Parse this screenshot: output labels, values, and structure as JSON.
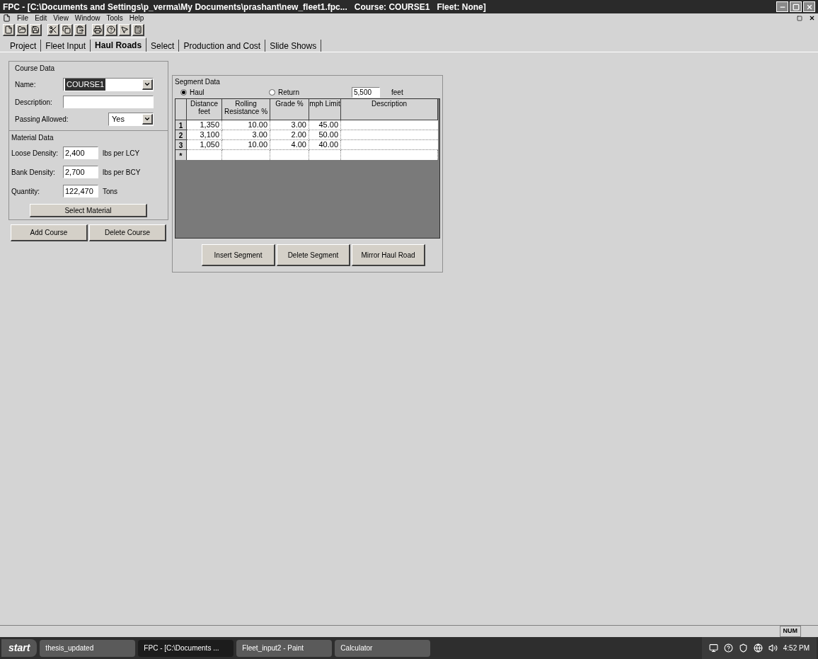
{
  "window": {
    "title": "FPC - [C:\\Documents and Settings\\p_verma\\My Documents\\prashant\\new_fleet1.fpc...   Course: COURSE1   Fleet: None]"
  },
  "menu": [
    "File",
    "Edit",
    "View",
    "Window",
    "Tools",
    "Help"
  ],
  "tabs": [
    {
      "label": "Project",
      "selected": false
    },
    {
      "label": "Fleet Input",
      "selected": false
    },
    {
      "label": "Haul Roads",
      "selected": true
    },
    {
      "label": "Select",
      "selected": false
    },
    {
      "label": "Production and Cost",
      "selected": false
    },
    {
      "label": "Slide Shows",
      "selected": false
    }
  ],
  "course_data": {
    "title": "Course Data",
    "name_label": "Name:",
    "name_value": "COURSE1",
    "description_label": "Description:",
    "passing_label": "Passing Allowed:",
    "passing_value": "Yes"
  },
  "material_data": {
    "title": "Material Data",
    "rows": [
      {
        "label": "Loose Density:",
        "value": "2,400",
        "unit": "lbs per LCY"
      },
      {
        "label": "Bank Density:",
        "value": "2,700",
        "unit": "lbs per BCY"
      },
      {
        "label": "Quantity:",
        "value": "122,470",
        "unit": "Tons"
      }
    ],
    "button": "Select Material"
  },
  "course_buttons": [
    "Add Course",
    "Delete Course"
  ],
  "segment_data": {
    "title": "Segment Data",
    "direction": [
      {
        "label": "Haul",
        "selected": true
      },
      {
        "label": "Return",
        "selected": false
      }
    ],
    "length": "5,500",
    "length_unit": "feet",
    "columns": [
      "Distance feet",
      "Rolling Resistance %",
      "Grade %",
      "mph Limit",
      "Description"
    ],
    "rows": [
      {
        "header": "1",
        "cells": [
          "1,350",
          "10.00",
          "3.00",
          "45.00"
        ]
      },
      {
        "header": "2",
        "cells": [
          "3,100",
          "3.00",
          "2.00",
          "50.00"
        ]
      },
      {
        "header": "3",
        "cells": [
          "1,050",
          "10.00",
          "4.00",
          "40.00"
        ]
      }
    ],
    "new_row_marker": "*"
  },
  "segment_buttons": [
    "Insert Segment",
    "Delete Segment",
    "Mirror Haul Road"
  ],
  "status_bar": {
    "indicator": "NUM"
  },
  "taskbar": {
    "start": "start",
    "tasks": [
      {
        "label": "thesis_updated",
        "selected": false
      },
      {
        "label": "FPC - [C:\\Documents ...",
        "selected": true
      },
      {
        "label": "Fleet_input2 - Paint",
        "selected": false
      },
      {
        "label": "Calculator",
        "selected": false
      }
    ],
    "clock": "4:52 PM"
  }
}
